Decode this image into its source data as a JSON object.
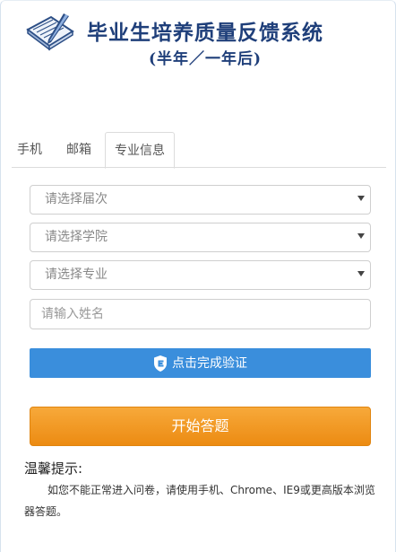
{
  "header": {
    "title": "毕业生培养质量反馈系统",
    "subtitle": "(半年／一年后)",
    "logo_icon": "notebook-pen-icon"
  },
  "tabs": [
    {
      "label": "手机",
      "active": false
    },
    {
      "label": "邮箱",
      "active": false
    },
    {
      "label": "专业信息",
      "active": true
    }
  ],
  "form": {
    "select_batch": "请选择届次",
    "select_college": "请选择学院",
    "select_major": "请选择专业",
    "name_placeholder": "请输入姓名"
  },
  "verify": {
    "label": "点击完成验证",
    "icon": "shield-e-icon"
  },
  "start_label": "开始答题",
  "tips": {
    "title": "温馨提示:",
    "text": "如您不能正常进入问卷，请使用手机、Chrome、IE9或更高版本浏览器答题。"
  },
  "colors": {
    "title": "#1f3f7a",
    "verify_button": "#3a8edc",
    "start_button": "#ec8b12"
  }
}
